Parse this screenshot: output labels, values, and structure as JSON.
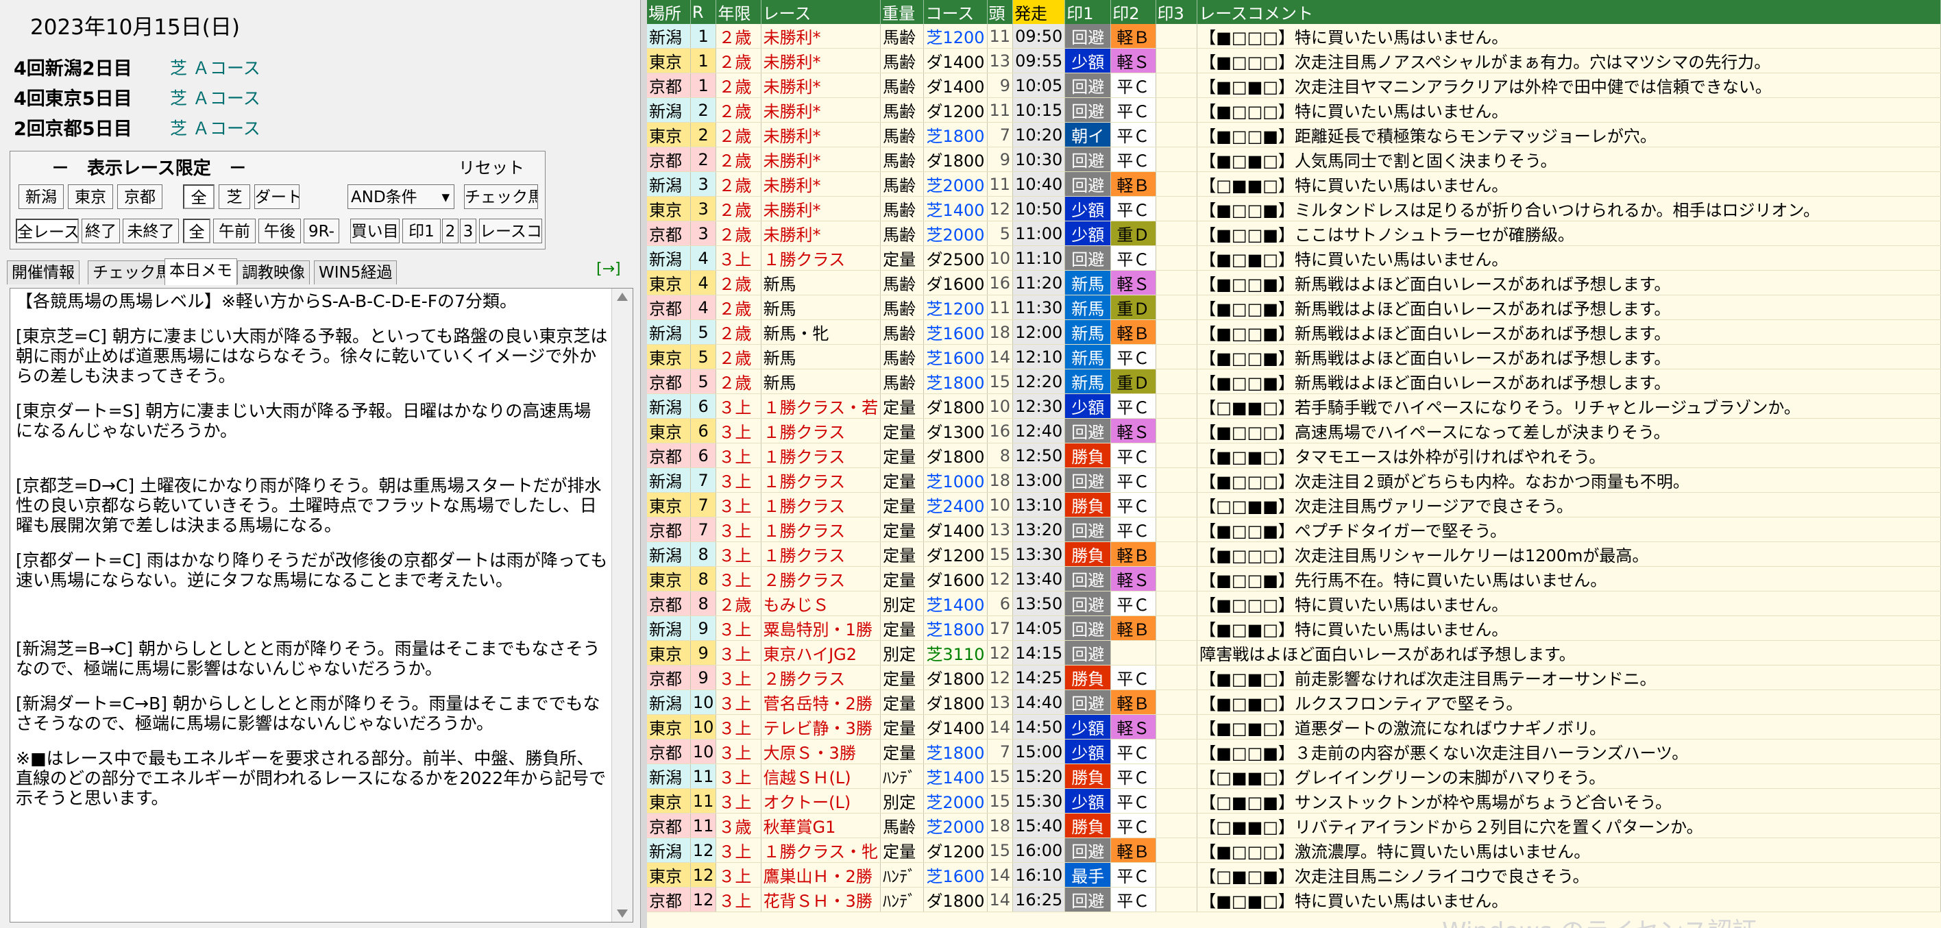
{
  "date": "2023年10月15日(日)",
  "meetings": [
    {
      "name": "4回新潟2日目",
      "course": "芝 Ａコース"
    },
    {
      "name": "4回東京5日目",
      "course": "芝 Ａコース"
    },
    {
      "name": "2回京都5日目",
      "course": "芝 Ａコース"
    }
  ],
  "filter": {
    "title": "－　表示レース限定　－",
    "reset": "リセット",
    "row1": [
      "新潟",
      "東京",
      "京都",
      "全",
      "芝",
      "ダート",
      "AND条件",
      "チェック馬"
    ],
    "row2": [
      "全レース",
      "終了",
      "未終了",
      "全",
      "午前",
      "午後",
      "9R-",
      "買い目",
      "印1",
      "2",
      "3",
      "レースコメ"
    ]
  },
  "tabs": [
    "開催情報",
    "チェック馬",
    "本日メモ",
    "調教映像",
    "WIN5経過"
  ],
  "arrow": "[→]",
  "memo": [
    "【各競馬場の馬場レベル】※軽い方からS-A-B-C-D-E-Fの7分類。",
    "[東京芝=C] 朝方に凄まじい大雨が降る予報。といっても路盤の良い東京芝は朝に雨が止めば道悪馬場にはならなそう。徐々に乾いていくイメージで外からの差しも決まってきそう。",
    "[東京ダート=S] 朝方に凄まじい大雨が降る予報。日曜はかなりの高速馬場になるんじゃないだろうか。",
    "",
    "[京都芝=D→C] 土曜夜にかなり雨が降りそう。朝は重馬場スタートだが排水性の良い京都なら乾いていきそう。土曜時点でフラットな馬場でしたし、日曜も展開次第で差しは決まる馬場になる。",
    "[京都ダート=C] 雨はかなり降りそうだが改修後の京都ダートは雨が降っても速い馬場にならない。逆にタフな馬場になることまで考えたい。",
    "",
    "",
    "[新潟芝=B→C] 朝からしとしとと雨が降りそう。雨量はそこまでもなさそうなので、極端に馬場に影響はないんじゃないだろうか。",
    "[新潟ダート=C→B] 朝からしとしとと雨が降りそう。雨量はそこまででもなさそうなので、極端に馬場に影響はないんじゃないだろうか。",
    "※■はレース中で最もエネルギーを要求される部分。前半、中盤、勝負所、直線のどの部分でエネルギーが問われるレースになるかを2022年から記号で示そうと思います。"
  ],
  "columns": [
    "場所",
    "R",
    "年限",
    "レース",
    "重量",
    "コース",
    "頭",
    "発走",
    "印1",
    "印2",
    "印3",
    "レースコメント"
  ],
  "colors": {
    "niigata": "#d6f4f4",
    "tokyo": "#ffe890",
    "kyoto": "#ffd4d4",
    "kaihi": "#808080",
    "shogaku": "#0030c8",
    "asa": "#0050a0",
    "shinba": "#0070d0",
    "shobu": "#e03000",
    "saisho": "#0060d0",
    "kei_b": "#ff9030",
    "kei_s": "#e080e0",
    "juu_d": "#a0a020",
    "hei_c": "#ffffff"
  },
  "races": [
    [
      "新潟",
      "1",
      "２歳",
      "未勝利*",
      "馬齢",
      "芝1200",
      "11",
      "09:50",
      "回避",
      "軽Ｂ",
      "",
      "【■□□□】特に買いたい馬はいません。"
    ],
    [
      "東京",
      "1",
      "２歳",
      "未勝利*",
      "馬齢",
      "ダ1400",
      "13",
      "09:55",
      "少額",
      "軽Ｓ",
      "",
      "【■□□□】次走注目馬ノアスペシャルがまぁ有力。穴はマツシマの先行力。"
    ],
    [
      "京都",
      "1",
      "２歳",
      "未勝利*",
      "馬齢",
      "ダ1400",
      "9",
      "10:05",
      "回避",
      "平Ｃ",
      "",
      "【■□■□】次走注目ヤマニンアラクリアは外枠で田中健では信頼できない。"
    ],
    [
      "新潟",
      "2",
      "２歳",
      "未勝利*",
      "馬齢",
      "ダ1200",
      "11",
      "10:15",
      "回避",
      "平Ｃ",
      "",
      "【■□□□】特に買いたい馬はいません。"
    ],
    [
      "東京",
      "2",
      "２歳",
      "未勝利*",
      "馬齢",
      "芝1800",
      "7",
      "10:20",
      "朝イ",
      "平Ｃ",
      "",
      "【■□□■】距離延長で積極策ならモンテマッジョーレが穴。"
    ],
    [
      "京都",
      "2",
      "２歳",
      "未勝利*",
      "馬齢",
      "ダ1800",
      "9",
      "10:30",
      "回避",
      "平Ｃ",
      "",
      "【■□■□】人気馬同士で割と固く決まりそう。"
    ],
    [
      "新潟",
      "3",
      "２歳",
      "未勝利*",
      "馬齢",
      "芝2000",
      "11",
      "10:40",
      "回避",
      "軽Ｂ",
      "",
      "【□■■□】特に買いたい馬はいません。"
    ],
    [
      "東京",
      "3",
      "２歳",
      "未勝利*",
      "馬齢",
      "芝1400",
      "12",
      "10:50",
      "少額",
      "平Ｃ",
      "",
      "【■□□■】ミルタンドレスは足りるが折り合いつけられるか。相手はロジリオン。"
    ],
    [
      "京都",
      "3",
      "２歳",
      "未勝利*",
      "馬齢",
      "芝2000",
      "5",
      "11:00",
      "少額",
      "重Ｄ",
      "",
      "【■□□■】ここはサトノシュトラーセが確勝級。"
    ],
    [
      "新潟",
      "4",
      "３上",
      "１勝クラス",
      "定量",
      "ダ2500",
      "10",
      "11:10",
      "回避",
      "平Ｃ",
      "",
      "【■□■□】特に買いたい馬はいません。"
    ],
    [
      "東京",
      "4",
      "２歳",
      "新馬",
      "馬齢",
      "ダ1600",
      "16",
      "11:20",
      "新馬",
      "軽Ｓ",
      "",
      "【■□□■】新馬戦はよほど面白いレースがあれば予想します。"
    ],
    [
      "京都",
      "4",
      "２歳",
      "新馬",
      "馬齢",
      "芝1200",
      "11",
      "11:30",
      "新馬",
      "重Ｄ",
      "",
      "【■□□■】新馬戦はよほど面白いレースがあれば予想します。"
    ],
    [
      "新潟",
      "5",
      "２歳",
      "新馬・牝",
      "馬齢",
      "芝1600",
      "18",
      "12:00",
      "新馬",
      "軽Ｂ",
      "",
      "【■□□■】新馬戦はよほど面白いレースがあれば予想します。"
    ],
    [
      "東京",
      "5",
      "２歳",
      "新馬",
      "馬齢",
      "芝1600",
      "14",
      "12:10",
      "新馬",
      "平Ｃ",
      "",
      "【■□□■】新馬戦はよほど面白いレースがあれば予想します。"
    ],
    [
      "京都",
      "5",
      "２歳",
      "新馬",
      "馬齢",
      "芝1800",
      "15",
      "12:20",
      "新馬",
      "重Ｄ",
      "",
      "【■□□■】新馬戦はよほど面白いレースがあれば予想します。"
    ],
    [
      "新潟",
      "6",
      "３上",
      "１勝クラス・若",
      "定量",
      "ダ1800",
      "10",
      "12:30",
      "少額",
      "平Ｃ",
      "",
      "【□■■□】若手騎手戦でハイペースになりそう。リチャとルージュブラゾンか。"
    ],
    [
      "東京",
      "6",
      "３上",
      "１勝クラス",
      "定量",
      "ダ1300",
      "16",
      "12:40",
      "回避",
      "軽Ｓ",
      "",
      "【■□□□】高速馬場でハイペースになって差しが決まりそう。"
    ],
    [
      "京都",
      "6",
      "３上",
      "１勝クラス",
      "定量",
      "ダ1800",
      "8",
      "12:50",
      "勝負",
      "平Ｃ",
      "",
      "【■□■□】タマモエースは外枠が引ければやれそう。"
    ],
    [
      "新潟",
      "7",
      "３上",
      "１勝クラス",
      "定量",
      "芝1000",
      "18",
      "13:00",
      "回避",
      "平Ｃ",
      "",
      "【■□□□】次走注目２頭がどちらも内枠。なおかつ雨量も不明。"
    ],
    [
      "東京",
      "7",
      "３上",
      "１勝クラス",
      "定量",
      "芝2400",
      "10",
      "13:10",
      "勝負",
      "平Ｃ",
      "",
      "【□□■■】次走注目馬ヴァリージアで良さそう。"
    ],
    [
      "京都",
      "7",
      "３上",
      "１勝クラス",
      "定量",
      "ダ1400",
      "13",
      "13:20",
      "回避",
      "平Ｃ",
      "",
      "【■□□■】ペプチドタイガーで堅そう。"
    ],
    [
      "新潟",
      "8",
      "３上",
      "１勝クラス",
      "定量",
      "ダ1200",
      "15",
      "13:30",
      "勝負",
      "軽Ｂ",
      "",
      "【■□□□】次走注目馬リシャールケリーは1200mが最高。"
    ],
    [
      "東京",
      "8",
      "３上",
      "２勝クラス",
      "定量",
      "ダ1600",
      "12",
      "13:40",
      "回避",
      "軽Ｓ",
      "",
      "【■□□■】先行馬不在。特に買いたい馬はいません。"
    ],
    [
      "京都",
      "8",
      "２歳",
      "もみじＳ",
      "別定",
      "芝1400",
      "6",
      "13:50",
      "回避",
      "平Ｃ",
      "",
      "【■□□□】特に買いたい馬はいません。"
    ],
    [
      "新潟",
      "9",
      "３上",
      "粟島特別・1勝",
      "定量",
      "芝1800",
      "17",
      "14:05",
      "回避",
      "軽Ｂ",
      "",
      "【■□■□】特に買いたい馬はいません。"
    ],
    [
      "東京",
      "9",
      "３上",
      "東京ハイJG2",
      "別定",
      "芝3110",
      "12",
      "14:15",
      "回避",
      "",
      "",
      "障害戦はよほど面白いレースがあれば予想します。"
    ],
    [
      "京都",
      "9",
      "３上",
      "２勝クラス",
      "定量",
      "ダ1800",
      "12",
      "14:25",
      "勝負",
      "平Ｃ",
      "",
      "【■□■□】前走影響なければ次走注目馬テーオーサンドニ。"
    ],
    [
      "新潟",
      "10",
      "３上",
      "菅名岳特・2勝",
      "定量",
      "ダ1800",
      "13",
      "14:40",
      "回避",
      "軽Ｂ",
      "",
      "【■□■□】ルクスフロンティアで堅そう。"
    ],
    [
      "東京",
      "10",
      "３上",
      "テレビ静・3勝",
      "定量",
      "ダ1400",
      "14",
      "14:50",
      "少額",
      "軽Ｓ",
      "",
      "【■□■□】道悪ダートの激流になればウナギノボリ。"
    ],
    [
      "京都",
      "10",
      "３上",
      "大原Ｓ・3勝",
      "定量",
      "芝1800",
      "7",
      "15:00",
      "少額",
      "平Ｃ",
      "",
      "【■□□■】３走前の内容が悪くない次走注目ハーランズハーツ。"
    ],
    [
      "新潟",
      "11",
      "３上",
      "信越ＳＨ(L)",
      "ﾊﾝﾃﾞ",
      "芝1400",
      "15",
      "15:20",
      "勝負",
      "平Ｃ",
      "",
      "【□■■□】グレイイングリーンの末脚がハマりそう。"
    ],
    [
      "東京",
      "11",
      "３上",
      "オクトー(L)",
      "別定",
      "芝2000",
      "15",
      "15:30",
      "少額",
      "平Ｃ",
      "",
      "【□■□■】サンストックトンが枠や馬場がちょうど合いそう。"
    ],
    [
      "京都",
      "11",
      "３歳",
      "秋華賞G1",
      "馬齢",
      "芝2000",
      "18",
      "15:40",
      "勝負",
      "平Ｃ",
      "",
      "【□■■□】リバティアイランドから２列目に穴を置くパターンか。"
    ],
    [
      "新潟",
      "12",
      "３上",
      "１勝クラス・牝",
      "定量",
      "ダ1200",
      "15",
      "16:00",
      "回避",
      "軽Ｂ",
      "",
      "【■□□□】激流濃厚。特に買いたい馬はいません。"
    ],
    [
      "東京",
      "12",
      "３上",
      "鷹巣山Ｈ・2勝",
      "ﾊﾝﾃﾞ",
      "芝1600",
      "14",
      "16:10",
      "最手",
      "平Ｃ",
      "",
      "【□■□■】次走注目馬ニシノライコウで良さそう。"
    ],
    [
      "京都",
      "12",
      "３上",
      "花背ＳＨ・3勝",
      "ﾊﾝﾃﾞ",
      "ダ1800",
      "14",
      "16:25",
      "回避",
      "平Ｃ",
      "",
      "【■□■□】特に買いたい馬はいません。"
    ]
  ],
  "watermark": "Windows のライセンス認証"
}
